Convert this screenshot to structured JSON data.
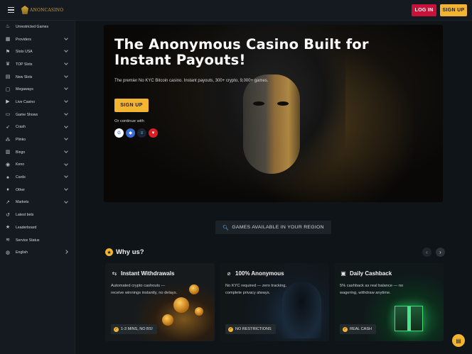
{
  "header": {
    "logo_text": "ANONCASINO",
    "login_label": "LOG IN",
    "signup_label": "SIGN UP"
  },
  "sidebar": {
    "items": [
      {
        "label": "Unrestricted Games",
        "icon": "flame-icon",
        "chevron": false
      },
      {
        "label": "Providers",
        "icon": "grid-icon",
        "chevron": true
      },
      {
        "label": "Slots USA",
        "icon": "flag-icon",
        "chevron": true
      },
      {
        "label": "TOP Slots",
        "icon": "trophy-icon",
        "chevron": true
      },
      {
        "label": "New Slots",
        "icon": "slot-icon",
        "chevron": true
      },
      {
        "label": "Megaways",
        "icon": "square-icon",
        "chevron": true
      },
      {
        "label": "Live Casino",
        "icon": "live-icon",
        "chevron": true
      },
      {
        "label": "Game Shows",
        "icon": "tv-icon",
        "chevron": true
      },
      {
        "label": "Crash",
        "icon": "rocket-icon",
        "chevron": true
      },
      {
        "label": "Plinko",
        "icon": "plinko-icon",
        "chevron": true
      },
      {
        "label": "Bingo",
        "icon": "bingo-icon",
        "chevron": true
      },
      {
        "label": "Keno",
        "icon": "keno-icon",
        "chevron": true
      },
      {
        "label": "Cards",
        "icon": "cards-icon",
        "chevron": true
      },
      {
        "label": "Other",
        "icon": "spade-icon",
        "chevron": true
      },
      {
        "label": "Markets",
        "icon": "chart-icon",
        "chevron": true
      },
      {
        "label": "Latest bets",
        "icon": "history-icon",
        "chevron": false
      },
      {
        "label": "Leaderboard",
        "icon": "star-icon",
        "chevron": false
      },
      {
        "label": "Service Status",
        "icon": "status-icon",
        "chevron": false
      },
      {
        "label": "English",
        "icon": "globe-icon",
        "chevron": "right"
      }
    ]
  },
  "hero": {
    "title": "The Anonymous Casino Built for Instant Payouts!",
    "subtitle": "The premier No KYC Bitcoin casino. Instant payouts, 300+ crypto, 9,000+ games.",
    "cta_label": "SIGN UP",
    "continue_label": "Or continue with",
    "socials": [
      {
        "name": "google-icon",
        "glyph": "G",
        "bg": "#ffffff",
        "fg": "#4285f4"
      },
      {
        "name": "ethereum-icon",
        "glyph": "◆",
        "bg": "#3b6bd6",
        "fg": "#ffffff"
      },
      {
        "name": "solana-icon",
        "glyph": "≡",
        "bg": "#1b2238",
        "fg": "#50e0c0"
      },
      {
        "name": "tron-icon",
        "glyph": "▼",
        "bg": "#d81f26",
        "fg": "#ffffff"
      }
    ]
  },
  "region_button": {
    "label": "GAMES AVAILABLE IN YOUR REGION"
  },
  "why": {
    "title": "Why us?"
  },
  "cards": [
    {
      "title": "Instant Withdrawals",
      "icon": "withdraw-icon",
      "desc": "Automated crypto cashouts — receive winnings instantly, no delays.",
      "badge": "1-3 MINS, NO BS!"
    },
    {
      "title": "100% Anonymous",
      "icon": "incognito-icon",
      "desc": "No KYC required — zero tracking, complete privacy always.",
      "badge": "NO RESTRICTIONS"
    },
    {
      "title": "Daily Cashback",
      "icon": "gift-icon",
      "desc": "5% cashback as real balance — no wagering, withdraw anytime.",
      "badge": "REAL CASH"
    }
  ],
  "colors": {
    "accent": "#f2b531",
    "login": "#c8123a",
    "bg": "#0f1418",
    "sidebar": "#141a1f"
  }
}
